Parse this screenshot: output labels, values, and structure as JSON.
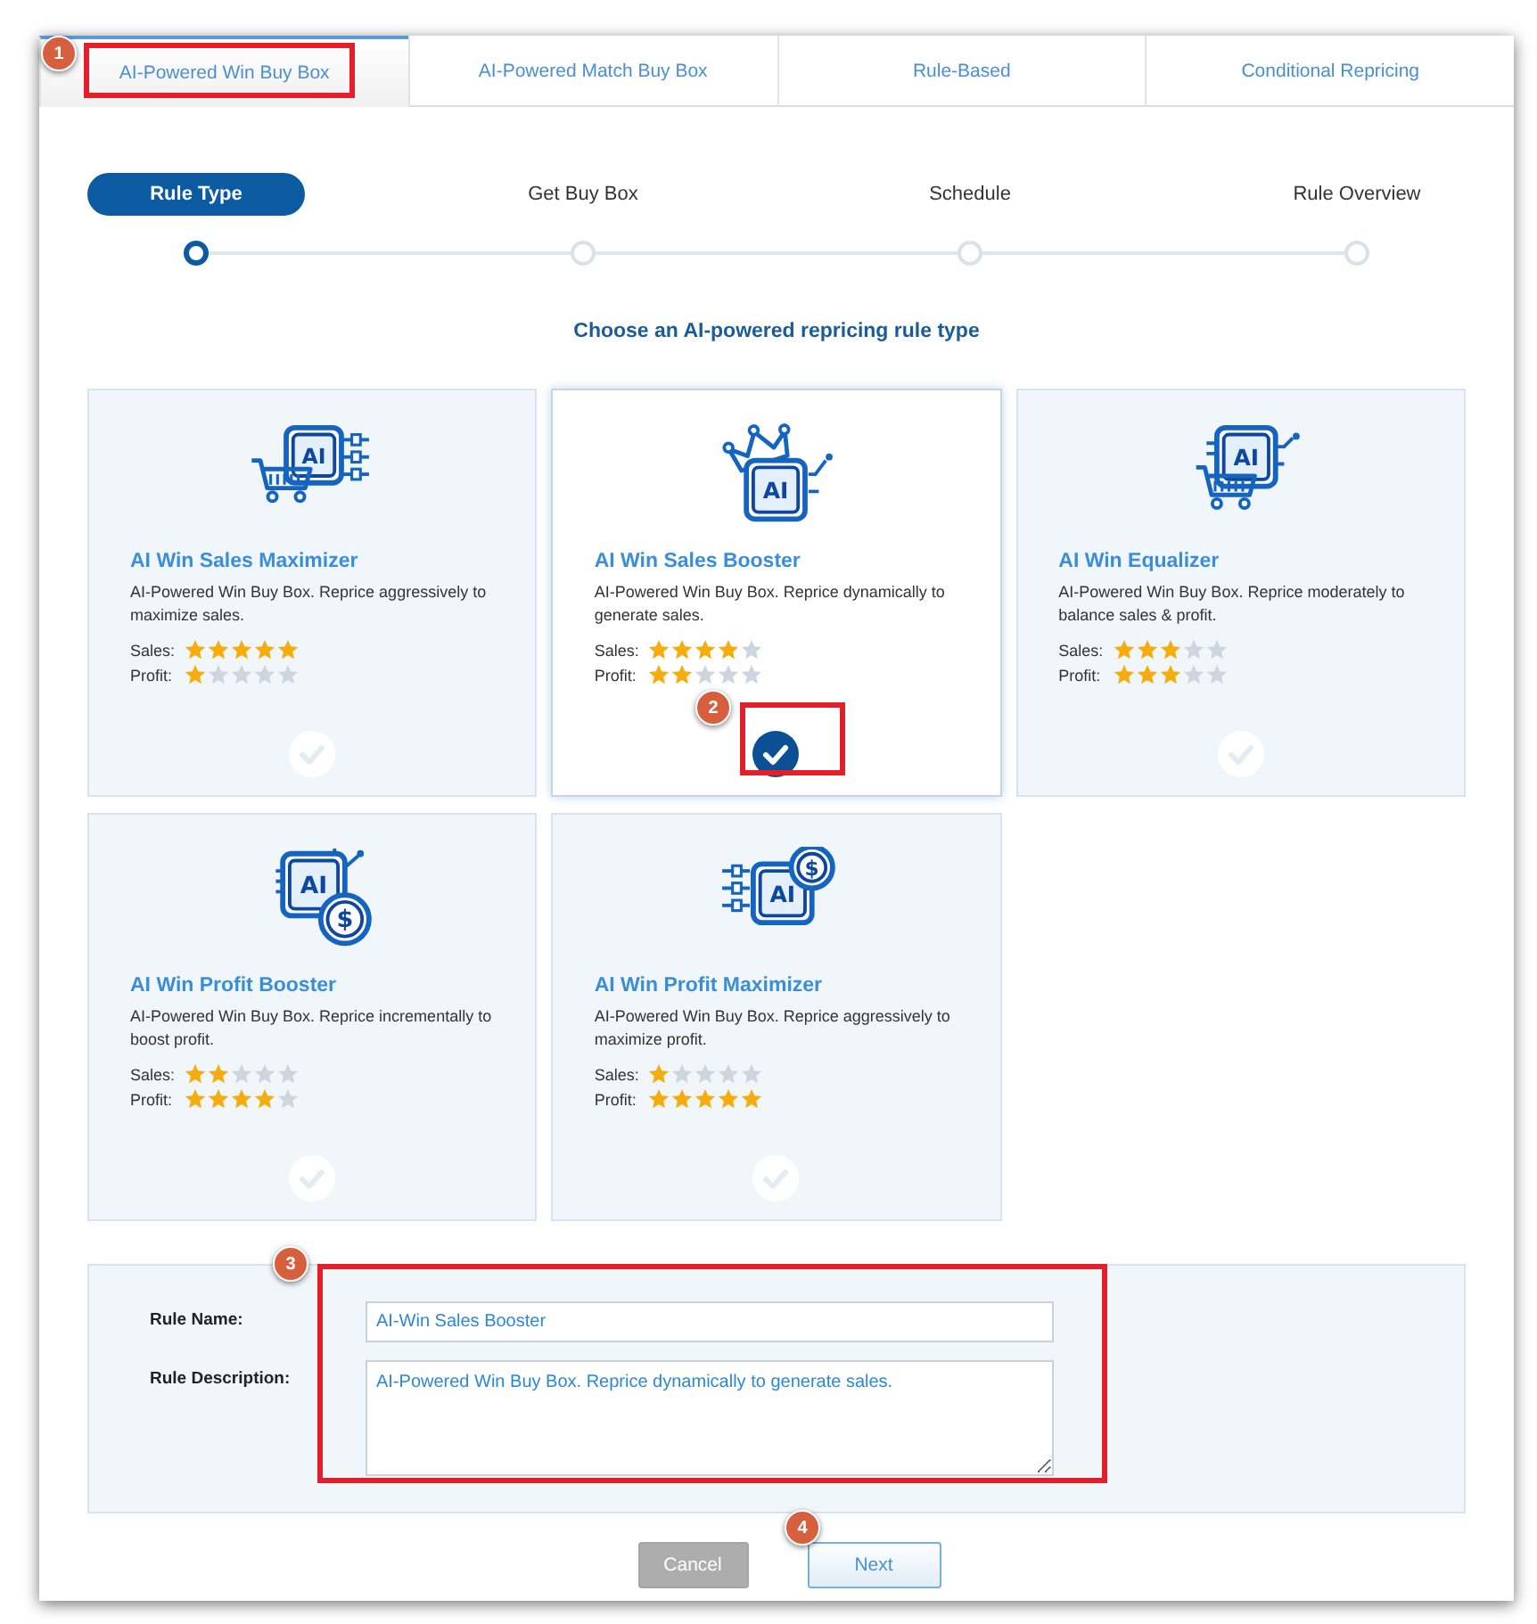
{
  "tabs": [
    {
      "label": "AI-Powered Win Buy Box",
      "selected": true
    },
    {
      "label": "AI-Powered Match Buy Box",
      "selected": false
    },
    {
      "label": "Rule-Based",
      "selected": false
    },
    {
      "label": "Conditional Repricing",
      "selected": false
    }
  ],
  "steps": [
    {
      "label": "Rule Type",
      "selected": true
    },
    {
      "label": "Get Buy Box",
      "selected": false
    },
    {
      "label": "Schedule",
      "selected": false
    },
    {
      "label": "Rule Overview",
      "selected": false
    }
  ],
  "heading": "Choose an AI-powered repricing rule type",
  "cards": [
    {
      "kind": "cart",
      "icon_text": "AI",
      "title": "AI Win Sales Maximizer",
      "description": "AI-Powered Win Buy Box. Reprice aggressively to maximize sales.",
      "ratings": [
        {
          "label": "Sales:",
          "stars": 5
        },
        {
          "label": "Profit:",
          "stars": 1
        }
      ],
      "selected": false
    },
    {
      "kind": "crown",
      "icon_text": "AI",
      "title": "AI Win Sales Booster",
      "description": "AI-Powered Win Buy Box. Reprice dynamically to generate sales.",
      "ratings": [
        {
          "label": "Sales:",
          "stars": 4
        },
        {
          "label": "Profit:",
          "stars": 2
        }
      ],
      "selected": true
    },
    {
      "kind": "cart-chip",
      "icon_text": "AI",
      "title": "AI Win Equalizer",
      "description": "AI-Powered Win Buy Box. Reprice moderately to balance sales & profit.",
      "ratings": [
        {
          "label": "Sales:",
          "stars": 3
        },
        {
          "label": "Profit:",
          "stars": 3
        }
      ],
      "selected": false
    },
    {
      "kind": "coin",
      "icon_text": "AI",
      "coin_text": "$",
      "title": "AI Win Profit Booster",
      "description": "AI-Powered Win Buy Box. Reprice incrementally to boost profit.",
      "ratings": [
        {
          "label": "Sales:",
          "stars": 2
        },
        {
          "label": "Profit:",
          "stars": 4
        }
      ],
      "selected": false
    },
    {
      "kind": "coin-top",
      "icon_text": "AI",
      "coin_text": "$",
      "title": "AI Win Profit Maximizer",
      "description": "AI-Powered Win Buy Box. Reprice aggressively to maximize profit.",
      "ratings": [
        {
          "label": "Sales:",
          "stars": 1
        },
        {
          "label": "Profit:",
          "stars": 5
        }
      ],
      "selected": false
    }
  ],
  "form": {
    "rule_name": {
      "label": "Rule Name:",
      "value": "AI-Win Sales Booster"
    },
    "rule_description": {
      "label": "Rule Description:",
      "value": "AI-Powered Win Buy Box. Reprice dynamically to generate sales."
    }
  },
  "buttons": [
    {
      "label": "Cancel",
      "disabled": true
    },
    {
      "label": "Next",
      "disabled": false
    }
  ],
  "annotations": [
    {
      "number": "1",
      "highlight": true
    },
    {
      "number": "2",
      "highlight": true
    },
    {
      "number": "3",
      "highlight": true
    },
    {
      "number": "4",
      "highlight": false
    }
  ]
}
